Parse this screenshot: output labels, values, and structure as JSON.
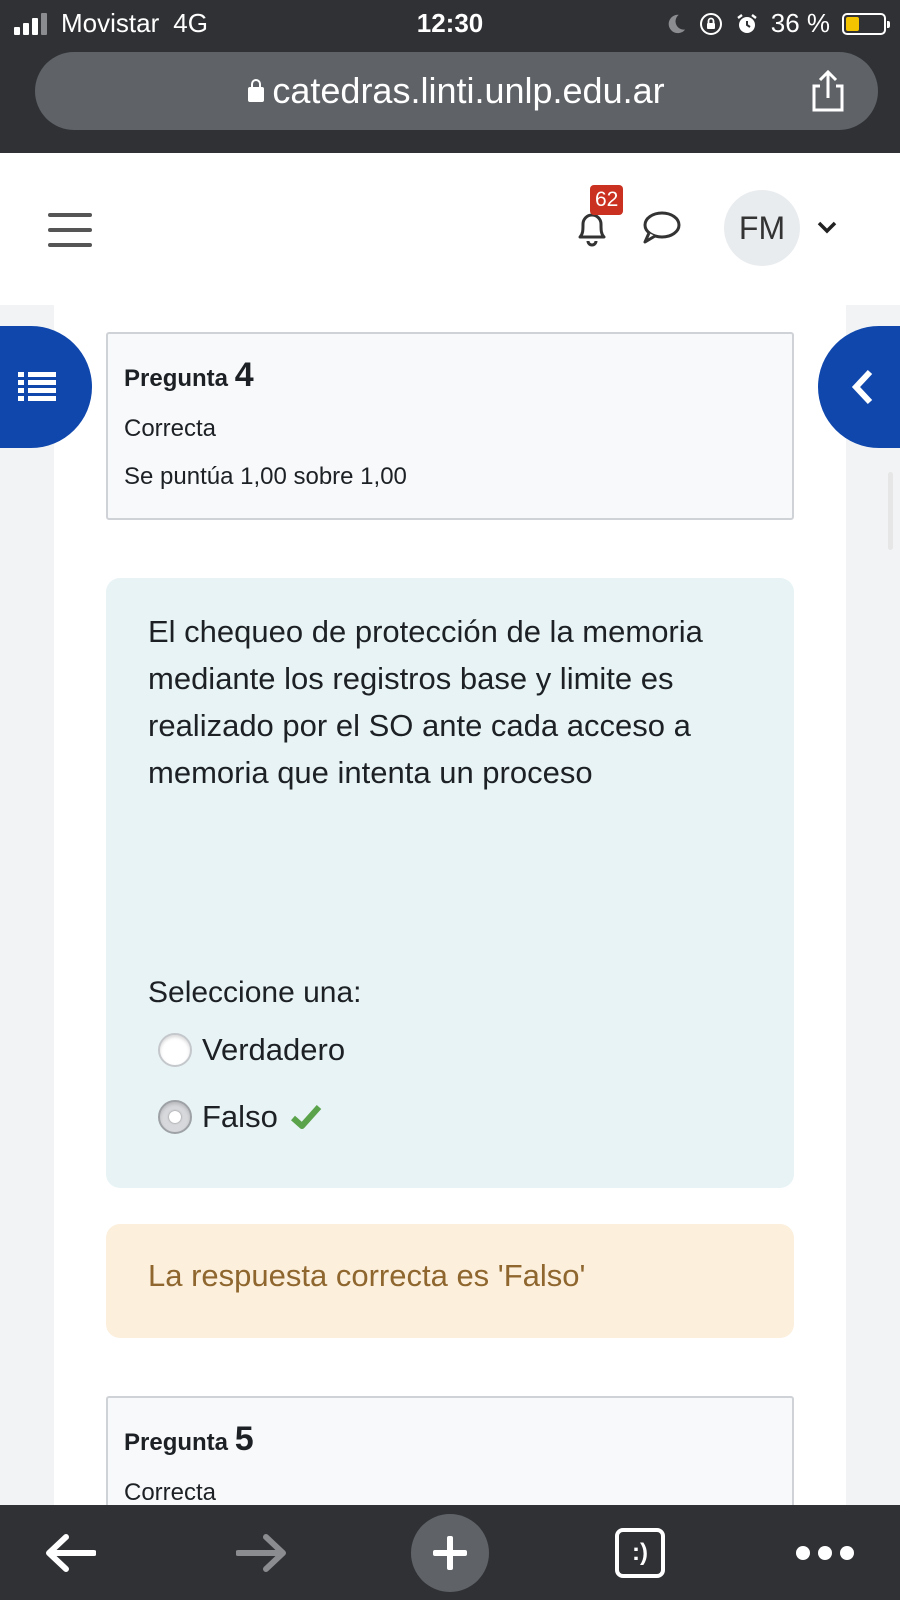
{
  "status_bar": {
    "carrier": "Movistar",
    "network": "4G",
    "time": "12:30",
    "battery_percent": "36 %",
    "battery_level": 0.36
  },
  "browser": {
    "url": "catedras.linti.unlp.edu.ar"
  },
  "header": {
    "notification_count": "62",
    "user_initials": "FM"
  },
  "question4": {
    "label": "Pregunta",
    "number": "4",
    "state": "Correcta",
    "grade": "Se puntúa 1,00 sobre 1,00",
    "text": "El chequeo de protección de la memoria mediante los registros base y limite es realizado por el SO ante cada acceso a memoria que intenta un proceso",
    "prompt": "Seleccione una:",
    "options": [
      {
        "label": "Verdadero",
        "selected": false
      },
      {
        "label": "Falso",
        "selected": true,
        "correct": true
      }
    ],
    "feedback": "La respuesta correcta es 'Falso'"
  },
  "question5": {
    "label": "Pregunta",
    "number": "5",
    "state": "Correcta"
  },
  "toolbar": {
    "tabs_label": ":)"
  },
  "colors": {
    "drawer_blue": "#0f47ad",
    "badge_red": "#ca3120",
    "correct_green": "#5aa34a",
    "feedback_bg": "#fcefdc",
    "formulation_bg": "#e7f3f5"
  }
}
